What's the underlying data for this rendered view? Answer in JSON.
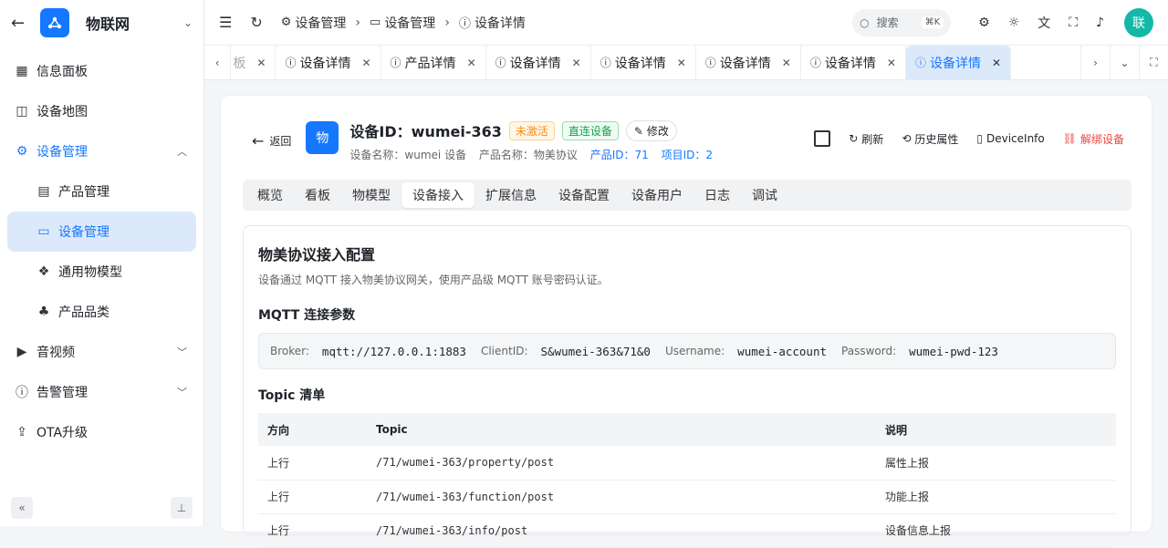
{
  "app": {
    "name": "物联网",
    "accent": "#1677ff"
  },
  "sidebar": {
    "items": [
      {
        "label": "信息面板"
      },
      {
        "label": "设备地图"
      },
      {
        "label": "设备管理"
      },
      {
        "label": "产品管理"
      },
      {
        "label": "设备管理"
      },
      {
        "label": "通用物模型"
      },
      {
        "label": "产品品类"
      },
      {
        "label": "音视频"
      },
      {
        "label": "告警管理"
      },
      {
        "label": "OTA升级"
      }
    ]
  },
  "breadcrumb": [
    "设备管理",
    "设备管理",
    "设备详情"
  ],
  "search": {
    "placeholder": "搜索",
    "shortcut": "⌘K"
  },
  "user": {
    "avatar": "联"
  },
  "tabs": {
    "partial": "板",
    "items": [
      "设备详情",
      "产品详情",
      "设备详情",
      "设备详情",
      "设备详情",
      "设备详情",
      "设备详情"
    ]
  },
  "device": {
    "back": "返回",
    "avatar": "物",
    "title": "设备ID：wumei-363",
    "status_tag": "未激活",
    "type_tag": "直连设备",
    "edit": "修改",
    "sub_name": "设备名称：wumei 设备",
    "sub_product": "产品名称：物美协议",
    "sub_product_id": "产品ID：71",
    "sub_project_id": "项目ID：2",
    "actions": {
      "refresh": "刷新",
      "history": "历史属性",
      "info": "DeviceInfo",
      "unbind": "解绑设备"
    }
  },
  "subtabs": [
    "概览",
    "看板",
    "物模型",
    "设备接入",
    "扩展信息",
    "设备配置",
    "设备用户",
    "日志",
    "调试"
  ],
  "access": {
    "title": "物美协议接入配置",
    "desc": "设备通过 MQTT 接入物美协议网关，使用产品级 MQTT 账号密码认证。",
    "params_title": "MQTT 连接参数",
    "params": [
      {
        "k": "Broker:",
        "v": "mqtt://127.0.0.1:1883"
      },
      {
        "k": "ClientID:",
        "v": "S&wumei-363&71&0"
      },
      {
        "k": "Username:",
        "v": "wumei-account"
      },
      {
        "k": "Password:",
        "v": "wumei-pwd-123"
      }
    ],
    "topics_title": "Topic 清单",
    "headers": [
      "方向",
      "Topic",
      "说明"
    ],
    "rows": [
      [
        "上行",
        "/71/wumei-363/property/post",
        "属性上报"
      ],
      [
        "上行",
        "/71/wumei-363/function/post",
        "功能上报"
      ],
      [
        "上行",
        "/71/wumei-363/info/post",
        "设备信息上报"
      ]
    ]
  }
}
